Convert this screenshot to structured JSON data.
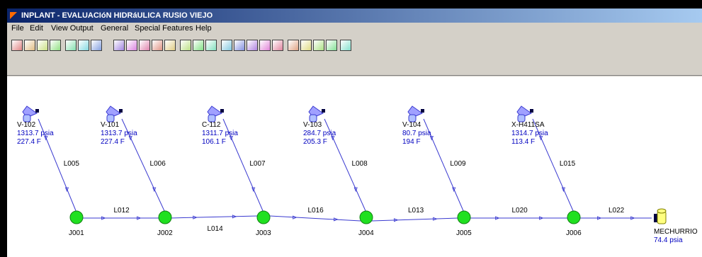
{
  "window": {
    "title": "INPLANT - EVALUACIóN HIDRáULICA RUSIO VIEJO"
  },
  "menu": [
    "File",
    "Edit",
    "View Output",
    "General",
    "Special Features",
    "Help"
  ],
  "toolbar": {
    "buttons": [
      "new-icon",
      "open-icon",
      "open-folder-icon",
      "save-icon",
      "run-icon",
      "report-icon",
      "print-icon",
      "pipe-icon",
      "arrow-icon",
      "junction-icon",
      "valve-icon",
      "node-icon",
      "grid-icon",
      "table-icon",
      "snowflake-icon",
      "ruler-icon",
      "fit-icon",
      "line-icon",
      "network-icon",
      "globe-icon",
      "zoom-in-icon",
      "zoom-out-icon",
      "zoom-window-icon",
      "edit-icon",
      "binoculars-icon"
    ]
  },
  "colors": {
    "source": "#3a3ad0",
    "line": "#3a3ad0",
    "junction": "#20e020",
    "text": "#000000",
    "value": "#0000c0"
  },
  "sources": [
    {
      "id": "V-102",
      "pressure": "1313.7 psia",
      "temp": "227.4 F"
    },
    {
      "id": "V-101",
      "pressure": "1313.7 psia",
      "temp": "227.4 F"
    },
    {
      "id": "C-112",
      "pressure": "1311.7 psia",
      "temp": "106.1 F"
    },
    {
      "id": "V-103",
      "pressure": "284.7 psia",
      "temp": "205.3 F"
    },
    {
      "id": "V-104",
      "pressure": "80.7 psia",
      "temp": "194 F"
    },
    {
      "id": "X-H411SA",
      "pressure": "1314.7 psia",
      "temp": "113.4 F"
    }
  ],
  "source_links": [
    "L005",
    "L006",
    "L007",
    "L008",
    "L009",
    "L015"
  ],
  "junctions": [
    "J001",
    "J002",
    "J003",
    "J004",
    "J005",
    "J006"
  ],
  "header_links": [
    "L012",
    "L014",
    "L016",
    "L013",
    "L020",
    "L022"
  ],
  "sink": {
    "id": "MECHURRIO",
    "pressure": "74.4 psia"
  }
}
